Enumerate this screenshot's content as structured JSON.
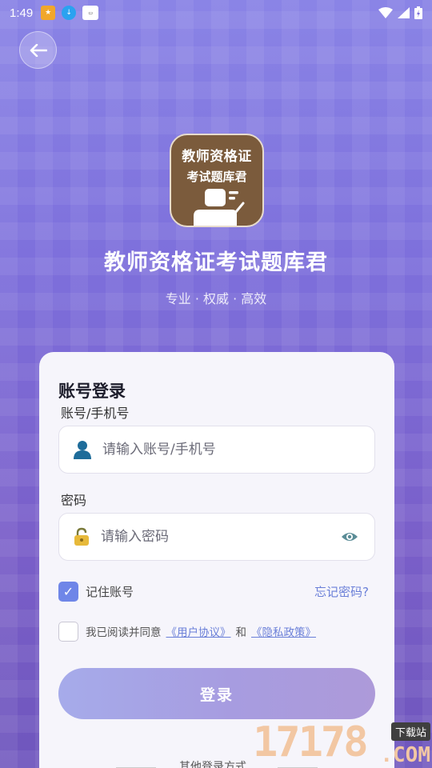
{
  "status_bar": {
    "time": "1:49"
  },
  "header": {
    "back_icon": "arrow-left-icon"
  },
  "app": {
    "logo_line1": "教师资格证",
    "logo_line2": "考试题库君",
    "title": "教师资格证考试题库君",
    "tagline": "专业 · 权威 · 高效"
  },
  "login": {
    "card_title": "账号登录",
    "account_label": "账号/手机号",
    "account_placeholder": "请输入账号/手机号",
    "account_value": "",
    "password_label": "密码",
    "password_placeholder": "请输入密码",
    "password_value": "",
    "remember_checked": "✓",
    "remember_label": "记住账号",
    "forgot_link": "忘记密码?",
    "agree_prefix": "我已阅读并同意",
    "user_agreement": "《用户协议》",
    "and_word": "和",
    "privacy_policy": "《隐私政策》",
    "login_button": "登录",
    "other_login": "其他登录方式"
  },
  "watermark": {
    "number": "17178",
    "badge": "下载站",
    "suffix": ".COM"
  },
  "colors": {
    "accent": "#6f86e8",
    "link": "#6a7fd8",
    "logo_bg": "#7b5b3c"
  }
}
